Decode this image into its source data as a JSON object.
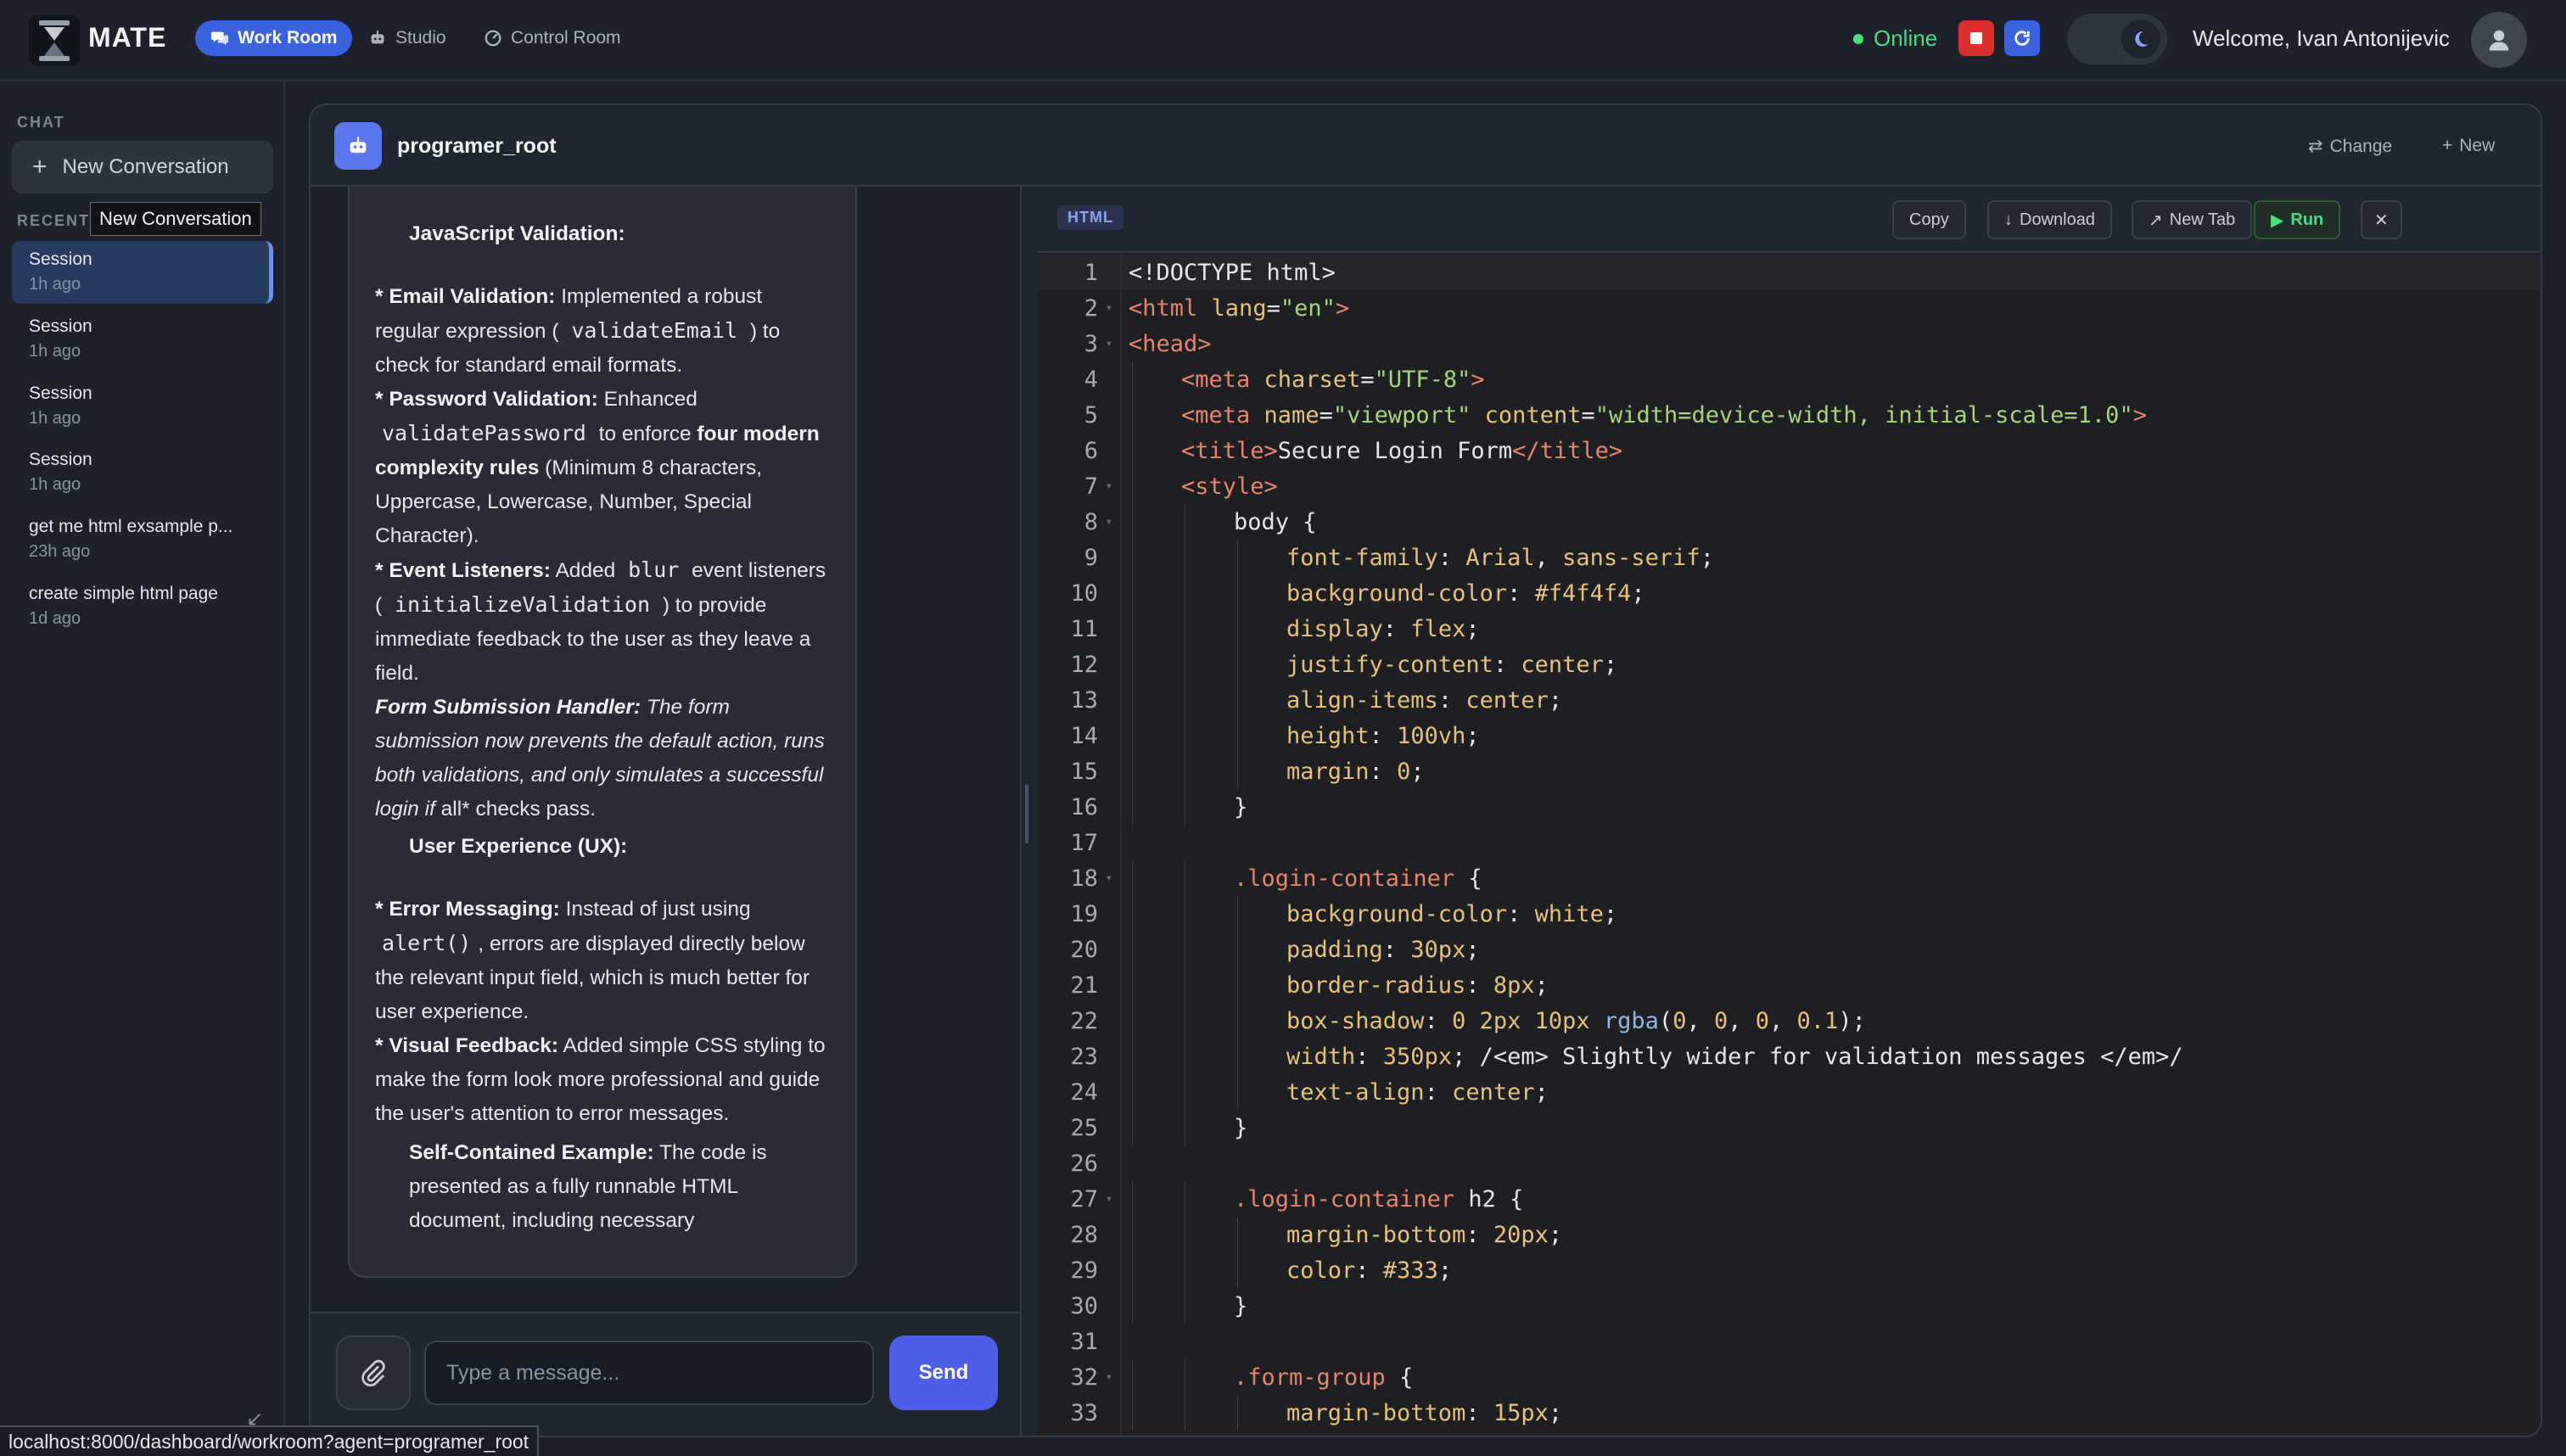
{
  "nav": {
    "brand": "MATE",
    "items": [
      {
        "label": "Work Room",
        "icon": "chat-bubbles-icon",
        "active": true
      },
      {
        "label": "Studio",
        "icon": "robot-icon",
        "active": false
      },
      {
        "label": "Control Room",
        "icon": "gauge-icon",
        "active": false
      }
    ],
    "status": "Online",
    "welcome": "Welcome, Ivan Antonijevic",
    "colors": {
      "accent": "#3b63e0",
      "online": "#4ade80",
      "stop": "#dc3030",
      "refresh": "#3b63e0"
    }
  },
  "sidebar": {
    "chat_label": "CHAT",
    "new_conversation": "New Conversation",
    "tooltip": "New Conversation",
    "recent_label": "RECENT",
    "sessions": [
      {
        "title": "Session",
        "time": "1h ago"
      },
      {
        "title": "Session",
        "time": "1h ago"
      },
      {
        "title": "Session",
        "time": "1h ago"
      },
      {
        "title": "Session",
        "time": "1h ago"
      },
      {
        "title": "get me html exsample p...",
        "time": "23h ago"
      },
      {
        "title": "create simple html page",
        "time": "1d ago"
      }
    ]
  },
  "header": {
    "agent_name": "programer_root",
    "change_label": "Change",
    "new_label": "New"
  },
  "message": {
    "heading_js": "JavaScript Validation:",
    "email_label": "* Email Validation:",
    "email_text_a": "Implemented a robust regular expression (",
    "email_code": "validateEmail",
    "email_text_b": ") to check for standard email formats.",
    "password_label": "* Password Validation:",
    "password_text_a": "Enhanced",
    "password_code": "validatePassword",
    "password_text_b": "to enforce",
    "password_bold": "four modern complexity rules",
    "password_text_c": "(Minimum 8 characters, Uppercase, Lowercase, Number, Special Character).",
    "events_label": "* Event Listeners:",
    "events_text_a": "Added",
    "events_code_a": "blur",
    "events_text_b": "event listeners (",
    "events_code_b": "initializeValidation",
    "events_text_c": ") to provide immediate feedback to the user as they leave a field.",
    "submit_label": "Form Submission Handler:",
    "submit_text": "The form submission now prevents the default action, runs both validations, and only simulates a successful login if",
    "submit_tail": "all* checks pass.",
    "heading_ux": "User Experience (UX):",
    "error_label": "* Error Messaging:",
    "error_text_a": "Instead of just using",
    "error_code": "alert()",
    "error_text_b": ", errors are displayed directly below the relevant input field, which is much better for user experience.",
    "visual_label": "* Visual Feedback:",
    "visual_text": "Added simple CSS styling to make the form look more professional and guide the user's attention to error messages.",
    "self_label": "Self-Contained Example:",
    "self_text": "The code is presented as a fully runnable HTML document, including necessary"
  },
  "composer": {
    "placeholder": "Type a message...",
    "send_label": "Send"
  },
  "code_panel": {
    "language": "HTML",
    "copy_label": "Copy",
    "download_label": "Download",
    "newtab_label": "New Tab",
    "run_label": "Run",
    "lines": [
      {
        "n": "1",
        "fold": false,
        "indent": 0,
        "tokens": [
          [
            "plain",
            "<!DOCTYPE html>"
          ]
        ]
      },
      {
        "n": "2",
        "fold": true,
        "indent": 0,
        "tokens": [
          [
            "tag",
            "<html "
          ],
          [
            "attr",
            "lang"
          ],
          [
            "plain",
            "="
          ],
          [
            "str",
            "\"en\""
          ],
          [
            "tag",
            ">"
          ]
        ]
      },
      {
        "n": "3",
        "fold": true,
        "indent": 0,
        "tokens": [
          [
            "tag",
            "<head>"
          ]
        ]
      },
      {
        "n": "4",
        "fold": false,
        "indent": 1,
        "tokens": [
          [
            "tag",
            "<meta "
          ],
          [
            "attr",
            "charset"
          ],
          [
            "plain",
            "="
          ],
          [
            "str",
            "\"UTF-8\""
          ],
          [
            "tag",
            ">"
          ]
        ]
      },
      {
        "n": "5",
        "fold": false,
        "indent": 1,
        "tokens": [
          [
            "tag",
            "<meta "
          ],
          [
            "attr",
            "name"
          ],
          [
            "plain",
            "="
          ],
          [
            "str",
            "\"viewport\""
          ],
          [
            "plain",
            " "
          ],
          [
            "attr",
            "content"
          ],
          [
            "plain",
            "="
          ],
          [
            "str",
            "\"width=device-width, initial-scale=1.0\""
          ],
          [
            "tag",
            ">"
          ]
        ]
      },
      {
        "n": "6",
        "fold": false,
        "indent": 1,
        "tokens": [
          [
            "tag",
            "<title>"
          ],
          [
            "plain",
            "Secure Login Form"
          ],
          [
            "tag",
            "</title>"
          ]
        ]
      },
      {
        "n": "7",
        "fold": true,
        "indent": 1,
        "tokens": [
          [
            "tag",
            "<style>"
          ]
        ]
      },
      {
        "n": "8",
        "fold": true,
        "indent": 2,
        "tokens": [
          [
            "plain",
            "body {"
          ]
        ]
      },
      {
        "n": "9",
        "fold": false,
        "indent": 3,
        "tokens": [
          [
            "prop",
            "font-family"
          ],
          [
            "plain",
            ": "
          ],
          [
            "val",
            "Arial"
          ],
          [
            "plain",
            ", "
          ],
          [
            "val",
            "sans-serif"
          ],
          [
            "plain",
            ";"
          ]
        ]
      },
      {
        "n": "10",
        "fold": false,
        "indent": 3,
        "tokens": [
          [
            "prop",
            "background-color"
          ],
          [
            "plain",
            ": "
          ],
          [
            "val",
            "#f4f4f4"
          ],
          [
            "plain",
            ";"
          ]
        ]
      },
      {
        "n": "11",
        "fold": false,
        "indent": 3,
        "tokens": [
          [
            "prop",
            "display"
          ],
          [
            "plain",
            ": "
          ],
          [
            "val",
            "flex"
          ],
          [
            "plain",
            ";"
          ]
        ]
      },
      {
        "n": "12",
        "fold": false,
        "indent": 3,
        "tokens": [
          [
            "prop",
            "justify-content"
          ],
          [
            "plain",
            ": "
          ],
          [
            "val",
            "center"
          ],
          [
            "plain",
            ";"
          ]
        ]
      },
      {
        "n": "13",
        "fold": false,
        "indent": 3,
        "tokens": [
          [
            "prop",
            "align-items"
          ],
          [
            "plain",
            ": "
          ],
          [
            "val",
            "center"
          ],
          [
            "plain",
            ";"
          ]
        ]
      },
      {
        "n": "14",
        "fold": false,
        "indent": 3,
        "tokens": [
          [
            "prop",
            "height"
          ],
          [
            "plain",
            ": "
          ],
          [
            "num",
            "100vh"
          ],
          [
            "plain",
            ";"
          ]
        ]
      },
      {
        "n": "15",
        "fold": false,
        "indent": 3,
        "tokens": [
          [
            "prop",
            "margin"
          ],
          [
            "plain",
            ": "
          ],
          [
            "num",
            "0"
          ],
          [
            "plain",
            ";"
          ]
        ]
      },
      {
        "n": "16",
        "fold": false,
        "indent": 2,
        "tokens": [
          [
            "plain",
            "}"
          ]
        ]
      },
      {
        "n": "17",
        "fold": false,
        "indent": 0,
        "tokens": [
          [
            "plain",
            ""
          ]
        ]
      },
      {
        "n": "18",
        "fold": true,
        "indent": 2,
        "tokens": [
          [
            "sel",
            ".login-container"
          ],
          [
            "plain",
            " {"
          ]
        ]
      },
      {
        "n": "19",
        "fold": false,
        "indent": 3,
        "tokens": [
          [
            "prop",
            "background-color"
          ],
          [
            "plain",
            ": "
          ],
          [
            "val",
            "white"
          ],
          [
            "plain",
            ";"
          ]
        ]
      },
      {
        "n": "20",
        "fold": false,
        "indent": 3,
        "tokens": [
          [
            "prop",
            "padding"
          ],
          [
            "plain",
            ": "
          ],
          [
            "num",
            "30px"
          ],
          [
            "plain",
            ";"
          ]
        ]
      },
      {
        "n": "21",
        "fold": false,
        "indent": 3,
        "tokens": [
          [
            "prop",
            "border-radius"
          ],
          [
            "plain",
            ": "
          ],
          [
            "num",
            "8px"
          ],
          [
            "plain",
            ";"
          ]
        ]
      },
      {
        "n": "22",
        "fold": false,
        "indent": 3,
        "tokens": [
          [
            "prop",
            "box-shadow"
          ],
          [
            "plain",
            ": "
          ],
          [
            "num",
            "0 2px 10px "
          ],
          [
            "fn",
            "rgba"
          ],
          [
            "plain",
            "("
          ],
          [
            "num",
            "0"
          ],
          [
            "plain",
            ", "
          ],
          [
            "num",
            "0"
          ],
          [
            "plain",
            ", "
          ],
          [
            "num",
            "0"
          ],
          [
            "plain",
            ", "
          ],
          [
            "num",
            "0.1"
          ],
          [
            "plain",
            ");"
          ]
        ]
      },
      {
        "n": "23",
        "fold": false,
        "indent": 3,
        "tokens": [
          [
            "prop",
            "width"
          ],
          [
            "plain",
            ": "
          ],
          [
            "num",
            "350px"
          ],
          [
            "plain",
            "; /<em> Slightly wider for validation messages </em>/"
          ]
        ]
      },
      {
        "n": "24",
        "fold": false,
        "indent": 3,
        "tokens": [
          [
            "prop",
            "text-align"
          ],
          [
            "plain",
            ": "
          ],
          [
            "val",
            "center"
          ],
          [
            "plain",
            ";"
          ]
        ]
      },
      {
        "n": "25",
        "fold": false,
        "indent": 2,
        "tokens": [
          [
            "plain",
            "}"
          ]
        ]
      },
      {
        "n": "26",
        "fold": false,
        "indent": 0,
        "tokens": [
          [
            "plain",
            ""
          ]
        ]
      },
      {
        "n": "27",
        "fold": true,
        "indent": 2,
        "tokens": [
          [
            "sel",
            ".login-container"
          ],
          [
            "plain",
            " h2 {"
          ]
        ]
      },
      {
        "n": "28",
        "fold": false,
        "indent": 3,
        "tokens": [
          [
            "prop",
            "margin-bottom"
          ],
          [
            "plain",
            ": "
          ],
          [
            "num",
            "20px"
          ],
          [
            "plain",
            ";"
          ]
        ]
      },
      {
        "n": "29",
        "fold": false,
        "indent": 3,
        "tokens": [
          [
            "prop",
            "color"
          ],
          [
            "plain",
            ": "
          ],
          [
            "val",
            "#333"
          ],
          [
            "plain",
            ";"
          ]
        ]
      },
      {
        "n": "30",
        "fold": false,
        "indent": 2,
        "tokens": [
          [
            "plain",
            "}"
          ]
        ]
      },
      {
        "n": "31",
        "fold": false,
        "indent": 0,
        "tokens": [
          [
            "plain",
            ""
          ]
        ]
      },
      {
        "n": "32",
        "fold": true,
        "indent": 2,
        "tokens": [
          [
            "sel",
            ".form-group"
          ],
          [
            "plain",
            " {"
          ]
        ]
      },
      {
        "n": "33",
        "fold": false,
        "indent": 3,
        "tokens": [
          [
            "prop",
            "margin-bottom"
          ],
          [
            "plain",
            ": "
          ],
          [
            "num",
            "15px"
          ],
          [
            "plain",
            ";"
          ]
        ]
      }
    ]
  },
  "status_url": "localhost:8000/dashboard/workroom?agent=programer_root"
}
